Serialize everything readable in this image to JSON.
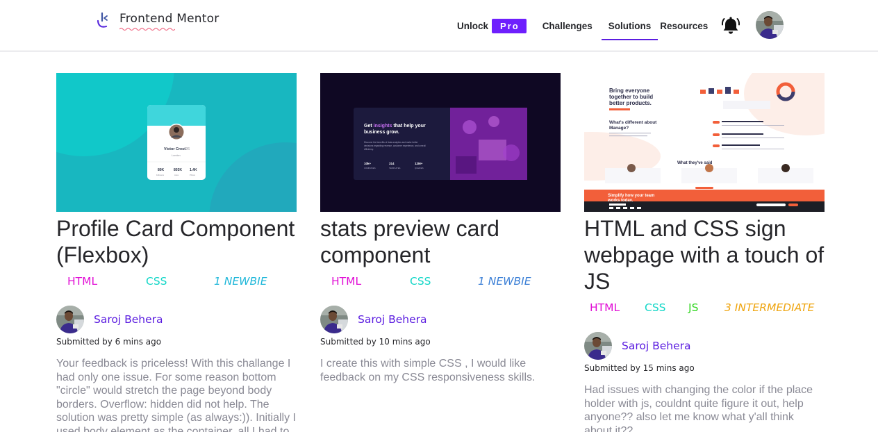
{
  "header": {
    "logo_text": "Frontend Mentor",
    "nav": {
      "unlock_label": "Unlock",
      "pro_label": "Pro",
      "challenges_label": "Challenges",
      "solutions_label": "Solutions",
      "resources_label": "Resources"
    },
    "icons": [
      "logo-icon",
      "bell-icon",
      "user-avatar"
    ]
  },
  "colors": {
    "accent": "#6e1ffd",
    "author_link": "#5b1de0",
    "tag_html": "#e10ed5",
    "tag_css": "#15d7c8",
    "tag_js": "#30d61f",
    "tag_newbie": "#1fb7d9",
    "tag_intermediate": "#efa510"
  },
  "solutions": [
    {
      "title": "Profile Card Component (Flexbox)",
      "tags": [
        "HTML",
        "CSS"
      ],
      "level": "1 NEWBIE",
      "author": "Saroj Behera",
      "submitted": "Submitted by 6 mins ago",
      "description": "Your feedback is priceless! With this challange I had only one issue. For some reason bottom \"circle\" would stretch the page beyond body borders. Overflow: hidden did not help. The solution was pretty simple (as always:)). Initially I used body element as the container, all I had to",
      "preview": {
        "name": "Victor Crest",
        "age": "26",
        "location": "London",
        "stats": [
          {
            "value": "80K",
            "label": "Followers"
          },
          {
            "value": "803K",
            "label": "Likes"
          },
          {
            "value": "1.4K",
            "label": "Photos"
          }
        ]
      }
    },
    {
      "title": "stats preview card component",
      "tags": [
        "HTML",
        "CSS"
      ],
      "level": "1 NEWBIE",
      "author": "Saroj Behera",
      "submitted": "Submitted by 10 mins ago",
      "description": "I create this with simple CSS , I would like feedback on my CSS responsiveness skills.",
      "preview": {
        "heading_pre": "Get ",
        "heading_hl": "insights",
        "heading_post": " that help your business grow.",
        "body": "Discover the benefits of data analytics and make better decisions regarding revenue, customer experience, and overall efficiency.",
        "stats": [
          {
            "value": "10k+",
            "label": "COMPANIES"
          },
          {
            "value": "314",
            "label": "TEMPLATES"
          },
          {
            "value": "12M+",
            "label": "QUERIES"
          }
        ]
      }
    },
    {
      "title": "HTML and CSS sign webpage with a touch of JS",
      "tags": [
        "HTML",
        "CSS",
        "JS"
      ],
      "level": "3 INTERMEDIATE",
      "author": "Saroj Behera",
      "submitted": "Submitted by 15 mins ago",
      "description": "Had issues with changing the color if the place holder with js, couldnt quite figure it out, help anyone?? also let me know what y'all think about it??",
      "preview": {
        "hero": "Bring everyone together to build better products.",
        "section": "What's different about Manage?",
        "testimonials": "What they've said",
        "footer_cta": "Simplify how your team works today."
      }
    }
  ]
}
